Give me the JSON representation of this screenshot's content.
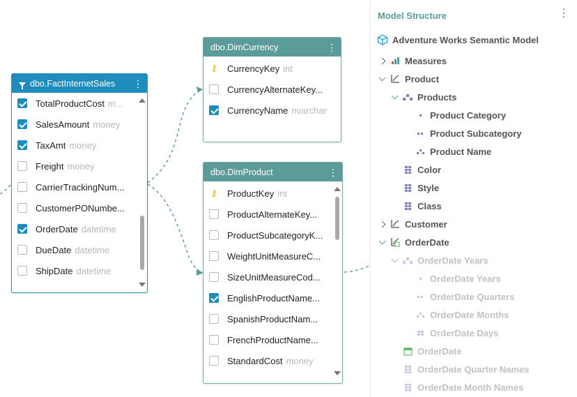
{
  "tables": {
    "fact": {
      "title": "dbo.FactInternetSales",
      "rows": [
        {
          "name": "TotalProductCost",
          "type": "m...",
          "checked": true
        },
        {
          "name": "SalesAmount",
          "type": "money",
          "checked": true
        },
        {
          "name": "TaxAmt",
          "type": "money",
          "checked": true
        },
        {
          "name": "Freight",
          "type": "money",
          "checked": false
        },
        {
          "name": "CarrierTrackingNum...",
          "type": "",
          "checked": false
        },
        {
          "name": "CustomerPONumbe...",
          "type": "",
          "checked": false
        },
        {
          "name": "OrderDate",
          "type": "datetime",
          "checked": true
        },
        {
          "name": "DueDate",
          "type": "datetime",
          "checked": false
        },
        {
          "name": "ShipDate",
          "type": "datetime",
          "checked": false
        }
      ]
    },
    "currency": {
      "title": "dbo.DimCurrency",
      "rows": [
        {
          "name": "CurrencyKey",
          "type": "int",
          "key": true
        },
        {
          "name": "CurrencyAlternateKey...",
          "type": "",
          "checked": false
        },
        {
          "name": "CurrencyName",
          "type": "nvarchar",
          "checked": true
        }
      ]
    },
    "product": {
      "title": "dbo.DimProduct",
      "rows": [
        {
          "name": "ProductKey",
          "type": "int",
          "key": true
        },
        {
          "name": "ProductAlternateKey...",
          "type": "",
          "checked": false
        },
        {
          "name": "ProductSubcategoryK...",
          "type": "",
          "checked": false
        },
        {
          "name": "WeightUnitMeasureC...",
          "type": "",
          "checked": false
        },
        {
          "name": "SizeUnitMeasureCod...",
          "type": "",
          "checked": false
        },
        {
          "name": "EnglishProductName...",
          "type": "",
          "checked": true
        },
        {
          "name": "SpanishProductNam...",
          "type": "",
          "checked": false
        },
        {
          "name": "FrenchProductName...",
          "type": "",
          "checked": false
        },
        {
          "name": "StandardCost",
          "type": "money",
          "checked": false
        }
      ]
    }
  },
  "panel": {
    "title": "Model Structure",
    "model_name": "Adventure Works Semantic Model",
    "items": [
      {
        "label": "Measures",
        "icon": "bar-chart-icon",
        "chevron": "right",
        "indent": 0,
        "faded": false
      },
      {
        "label": "Product",
        "icon": "dimension-icon",
        "chevron": "down",
        "indent": 0,
        "faded": false
      },
      {
        "label": "Products",
        "icon": "hierarchy-icon",
        "chevron": "down",
        "indent": 1,
        "faded": false
      },
      {
        "label": "Product Category",
        "icon": "level1-icon",
        "chevron": "",
        "indent": 2,
        "faded": false
      },
      {
        "label": "Product Subcategory",
        "icon": "level2-icon",
        "chevron": "",
        "indent": 2,
        "faded": false
      },
      {
        "label": "Product Name",
        "icon": "level3-icon",
        "chevron": "",
        "indent": 2,
        "faded": false
      },
      {
        "label": "Color",
        "icon": "attribute-icon",
        "chevron": "",
        "indent": 1,
        "faded": false
      },
      {
        "label": "Style",
        "icon": "attribute-icon",
        "chevron": "",
        "indent": 1,
        "faded": false
      },
      {
        "label": "Class",
        "icon": "attribute-icon",
        "chevron": "",
        "indent": 1,
        "faded": false
      },
      {
        "label": "Customer",
        "icon": "dimension-icon",
        "chevron": "right",
        "indent": 0,
        "faded": false
      },
      {
        "label": "OrderDate",
        "icon": "date-dimension-icon",
        "chevron": "down",
        "indent": 0,
        "faded": false
      },
      {
        "label": "OrderDate Years",
        "icon": "hierarchy-icon",
        "chevron": "down",
        "indent": 1,
        "faded": true
      },
      {
        "label": "OrderDate Years",
        "icon": "level1-icon",
        "chevron": "",
        "indent": 2,
        "faded": true
      },
      {
        "label": "OrderDate Quarters",
        "icon": "level2-icon",
        "chevron": "",
        "indent": 2,
        "faded": true
      },
      {
        "label": "OrderDate Months",
        "icon": "level3-icon",
        "chevron": "",
        "indent": 2,
        "faded": true
      },
      {
        "label": "OrderDate Days",
        "icon": "level4-icon",
        "chevron": "",
        "indent": 2,
        "faded": true
      },
      {
        "label": "OrderDate",
        "icon": "calendar-icon",
        "chevron": "",
        "indent": 1,
        "faded": true
      },
      {
        "label": "OrderDate Quarter Names",
        "icon": "attribute-icon",
        "chevron": "",
        "indent": 1,
        "faded": true
      },
      {
        "label": "OrderDate Month Names",
        "icon": "attribute-icon",
        "chevron": "",
        "indent": 1,
        "faded": true
      }
    ]
  },
  "colors": {
    "accent_blue": "#1e8dbc",
    "accent_teal": "#5b9c9a",
    "icon_purple": "#7f7fba"
  }
}
